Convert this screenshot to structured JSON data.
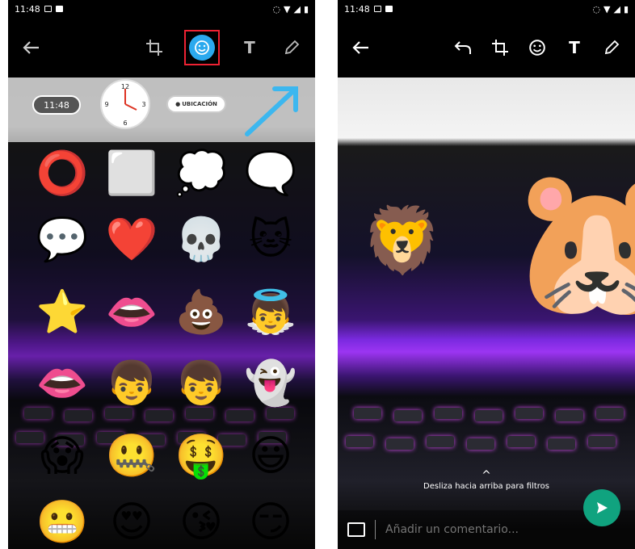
{
  "left_screen": {
    "status": {
      "time": "11:48"
    },
    "toolbar": {
      "back": "back-arrow-icon",
      "tools": [
        "crop-rotate-icon",
        "emoji-icon",
        "text-icon",
        "pencil-icon"
      ],
      "text_tool_label": "T",
      "accent": "#2ba9ee",
      "highlight": "#e23333"
    },
    "tray": {
      "time_sticker": "11:48",
      "clock_numbers": [
        "12",
        "3",
        "6",
        "9"
      ],
      "location_sticker": "UBICACIÓN"
    },
    "stickers": [
      "⭕",
      "⬜",
      "💭",
      "🗨️",
      "💬",
      "❤️",
      "💀",
      "🐱",
      "⭐",
      "👄",
      "💩",
      "👼",
      "👄",
      "👦",
      "👦",
      "👻",
      "😱",
      "🤐",
      "🤑",
      "😃",
      "😬",
      "😍",
      "😘",
      "😏"
    ]
  },
  "right_screen": {
    "status": {
      "time": "11:48"
    },
    "toolbar": {
      "back": "back-arrow-icon",
      "tools": [
        "undo-icon",
        "crop-rotate-icon",
        "emoji-icon",
        "text-icon",
        "pencil-icon"
      ],
      "text_tool_label": "T"
    },
    "placed_stickers": [
      "🦁",
      "🐹"
    ],
    "swipe_hint": "Desliza hacia arriba para filtros",
    "comment": {
      "placeholder": "Añadir un comentario..."
    },
    "send_color": "#10a37f"
  }
}
